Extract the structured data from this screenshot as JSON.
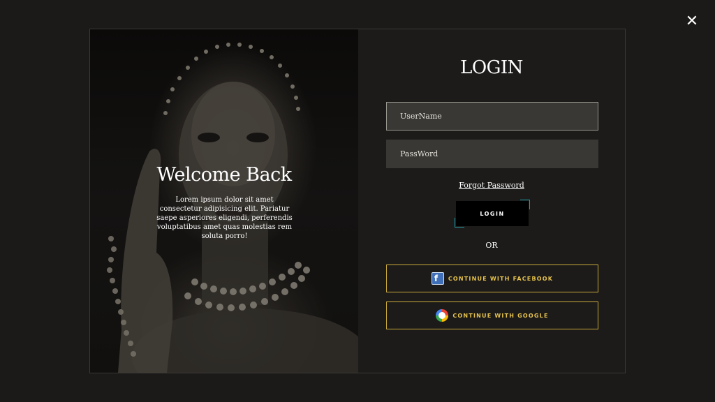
{
  "close": {
    "icon": "close-icon",
    "glyph": "✕"
  },
  "hero": {
    "title": "Welcome Back",
    "text": "Lorem ipsum dolor sit amet consectetur adipisicing elit. Pariatur saepe asperiores eligendi, perferendis voluptatibus amet quas molestias rem soluta porro!"
  },
  "form": {
    "title": "LOGIN",
    "username_placeholder": "UserName",
    "password_placeholder": "PassWord",
    "forgot_label": "Forgot Password",
    "login_label": "LOGIN",
    "or_label": "OR",
    "facebook_label": "CONTINUE WITH FACEBOOK",
    "google_label": "CONTINUE WITH GOOGLE"
  },
  "colors": {
    "background": "#1b1a19",
    "input_bg": "#393834",
    "accent_gold": "#e6c24d",
    "accent_teal": "#1f9aa3"
  }
}
